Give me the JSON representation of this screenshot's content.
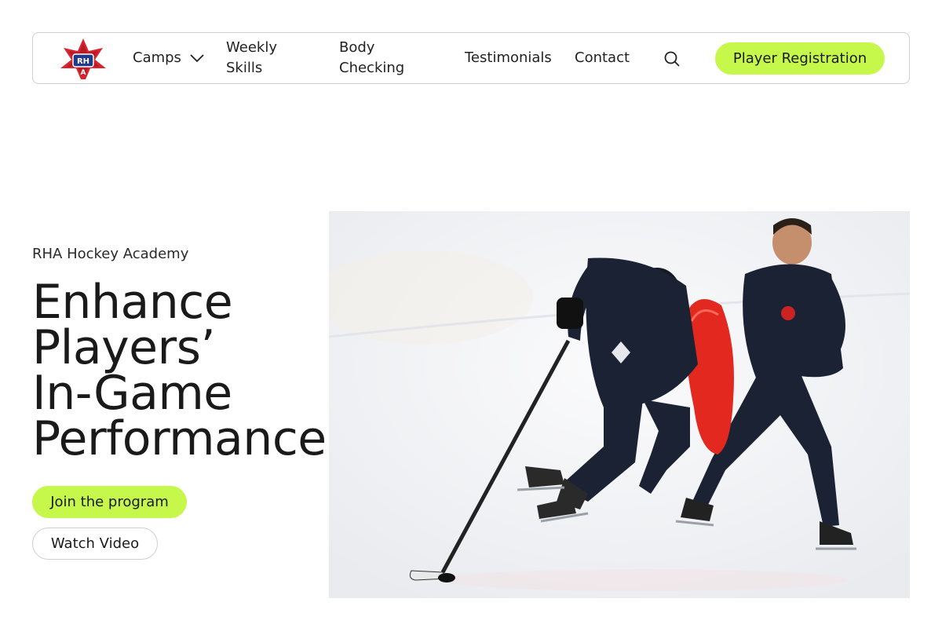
{
  "nav": {
    "logo_icon": "rha-hockey-academy-logo",
    "items": [
      {
        "label": "Camps",
        "has_dropdown": true
      },
      {
        "label": "Weekly Skills"
      },
      {
        "label": "Body Checking"
      },
      {
        "label": "Testimonials"
      },
      {
        "label": "Contact"
      }
    ],
    "search_icon": "search-icon",
    "register_label": "Player Registration"
  },
  "hero": {
    "eyebrow": "RHA Hockey Academy",
    "headline_lines": [
      "Enhance",
      "Players’",
      "In-Game",
      "Performance"
    ],
    "primary_cta": "Join the program",
    "secondary_cta": "Watch Video",
    "image_alt": "Coach training a hockey player on ice with a red blocking pad"
  },
  "colors": {
    "accent": "#c6f74b",
    "text": "#1a1a1a",
    "border": "#cfcfcf",
    "player_uniform": "#1b2233",
    "pad_red": "#e3281f"
  }
}
